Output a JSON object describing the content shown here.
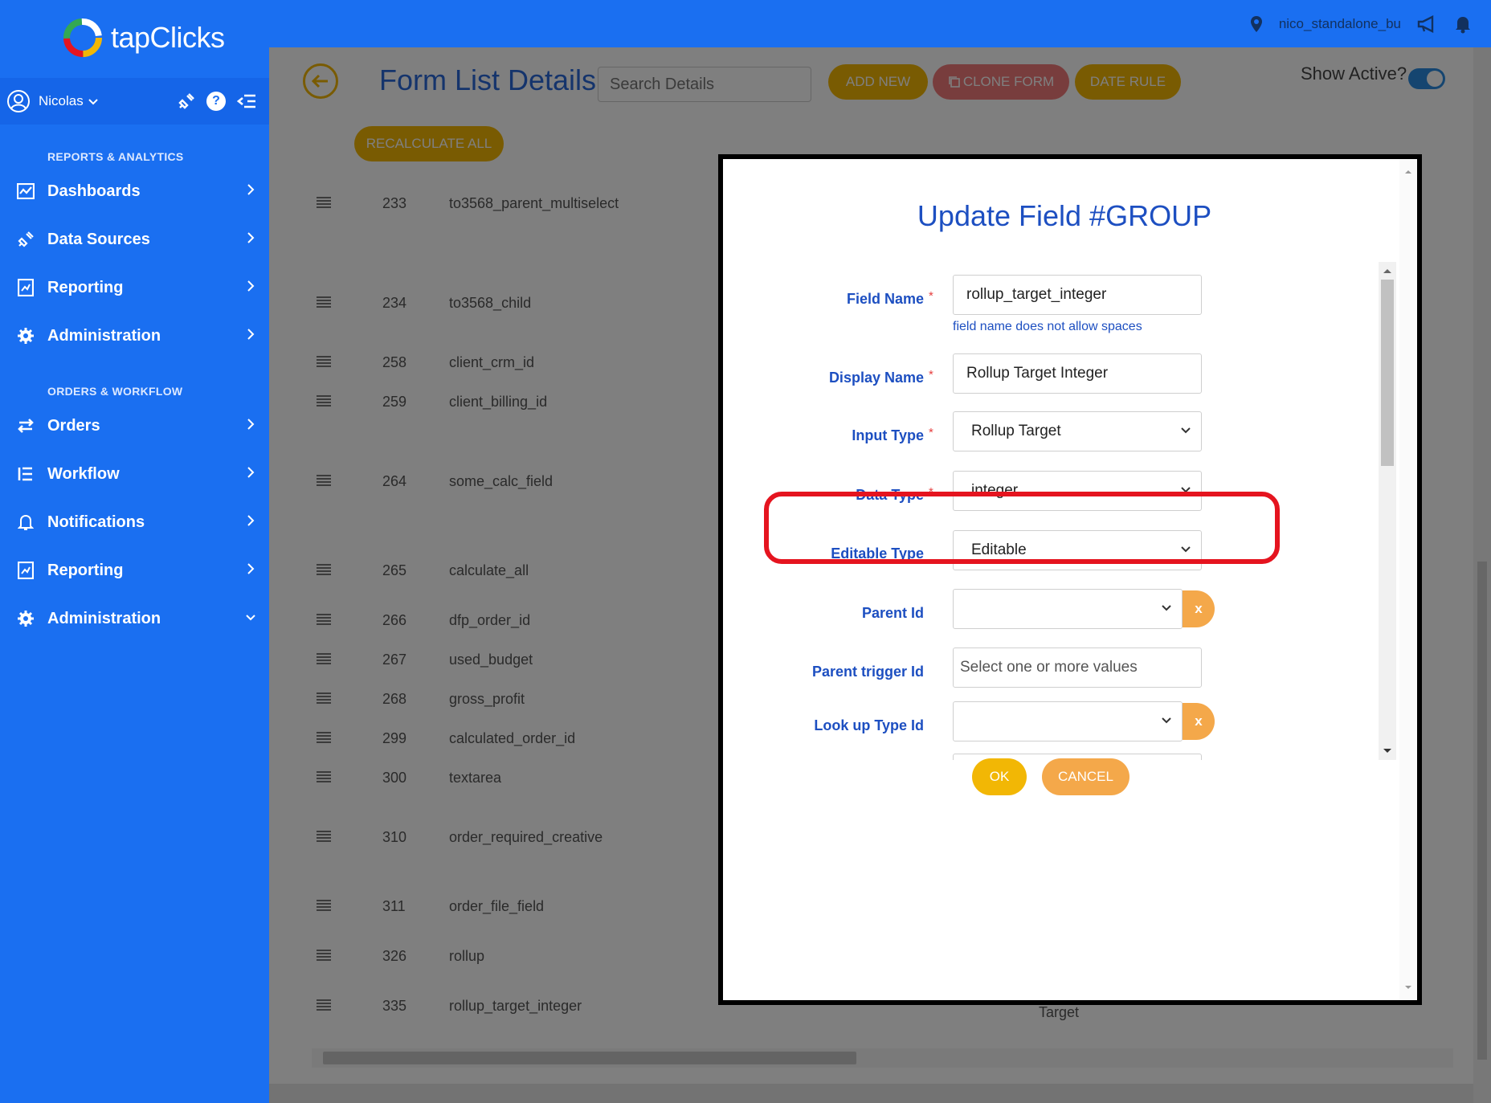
{
  "brand": {
    "logo_text": "tapClicks"
  },
  "topbar": {
    "location": "nico_standalone_bu"
  },
  "user": {
    "name": "Nicolas"
  },
  "sidebar": {
    "sections": [
      {
        "title": "REPORTS & ANALYTICS",
        "items": [
          {
            "label": "Dashboards",
            "icon": "chart-icon"
          },
          {
            "label": "Data Sources",
            "icon": "plug-icon"
          },
          {
            "label": "Reporting",
            "icon": "report-icon"
          },
          {
            "label": "Administration",
            "icon": "gear-icon"
          }
        ]
      },
      {
        "title": "ORDERS & WORKFLOW",
        "items": [
          {
            "label": "Orders",
            "icon": "swap-icon"
          },
          {
            "label": "Workflow",
            "icon": "list-icon"
          },
          {
            "label": "Notifications",
            "icon": "bell-icon"
          },
          {
            "label": "Reporting",
            "icon": "report-icon"
          },
          {
            "label": "Administration",
            "icon": "gear-icon"
          }
        ]
      }
    ]
  },
  "page": {
    "title": "Form List Details",
    "search_placeholder": "Search Details",
    "buttons": {
      "add_new": "ADD NEW",
      "clone_form": "CLONE FORM",
      "date_rule": "DATE RULE",
      "recalculate_all": "RECALCULATE ALL"
    },
    "show_active_label": "Show Active?",
    "rows": [
      {
        "id": "233",
        "name": "to3568_parent_multiselect"
      },
      {
        "id": "234",
        "name": "to3568_child"
      },
      {
        "id": "258",
        "name": "client_crm_id"
      },
      {
        "id": "259",
        "name": "client_billing_id"
      },
      {
        "id": "264",
        "name": "some_calc_field"
      },
      {
        "id": "265",
        "name": "calculate_all"
      },
      {
        "id": "266",
        "name": "dfp_order_id"
      },
      {
        "id": "267",
        "name": "used_budget"
      },
      {
        "id": "268",
        "name": "gross_profit"
      },
      {
        "id": "299",
        "name": "calculated_order_id"
      },
      {
        "id": "300",
        "name": "textarea"
      },
      {
        "id": "310",
        "name": "order_required_creative"
      },
      {
        "id": "311",
        "name": "order_file_field"
      },
      {
        "id": "326",
        "name": "rollup"
      },
      {
        "id": "335",
        "name": "rollup_target_integer"
      }
    ],
    "partial_visible_cell": "Target"
  },
  "modal": {
    "title": "Update Field #GROUP",
    "required_mark": "*",
    "fields": {
      "field_name": {
        "label": "Field Name",
        "value": "rollup_target_integer",
        "hint": "field name does not allow spaces"
      },
      "display_name": {
        "label": "Display Name",
        "value": "Rollup Target Integer"
      },
      "input_type": {
        "label": "Input Type",
        "value": "Rollup Target"
      },
      "data_type": {
        "label": "Data Type",
        "value": "integer"
      },
      "editable_type": {
        "label": "Editable Type",
        "value": "Editable"
      },
      "parent_id": {
        "label": "Parent Id",
        "value": ""
      },
      "parent_trigger_id": {
        "label": "Parent trigger Id",
        "placeholder": "Select one or more values"
      },
      "lookup_type_id": {
        "label": "Look up Type Id",
        "value": ""
      }
    },
    "clear_label": "x",
    "ok_label": "OK",
    "cancel_label": "CANCEL"
  },
  "colors": {
    "brand_blue": "#1a6ff1",
    "accent_yellow": "#f2b705",
    "accent_orange": "#f4a84a",
    "clone_red": "#f07a7a",
    "highlight_red": "#e5141f",
    "label_blue": "#1d4fc1"
  }
}
